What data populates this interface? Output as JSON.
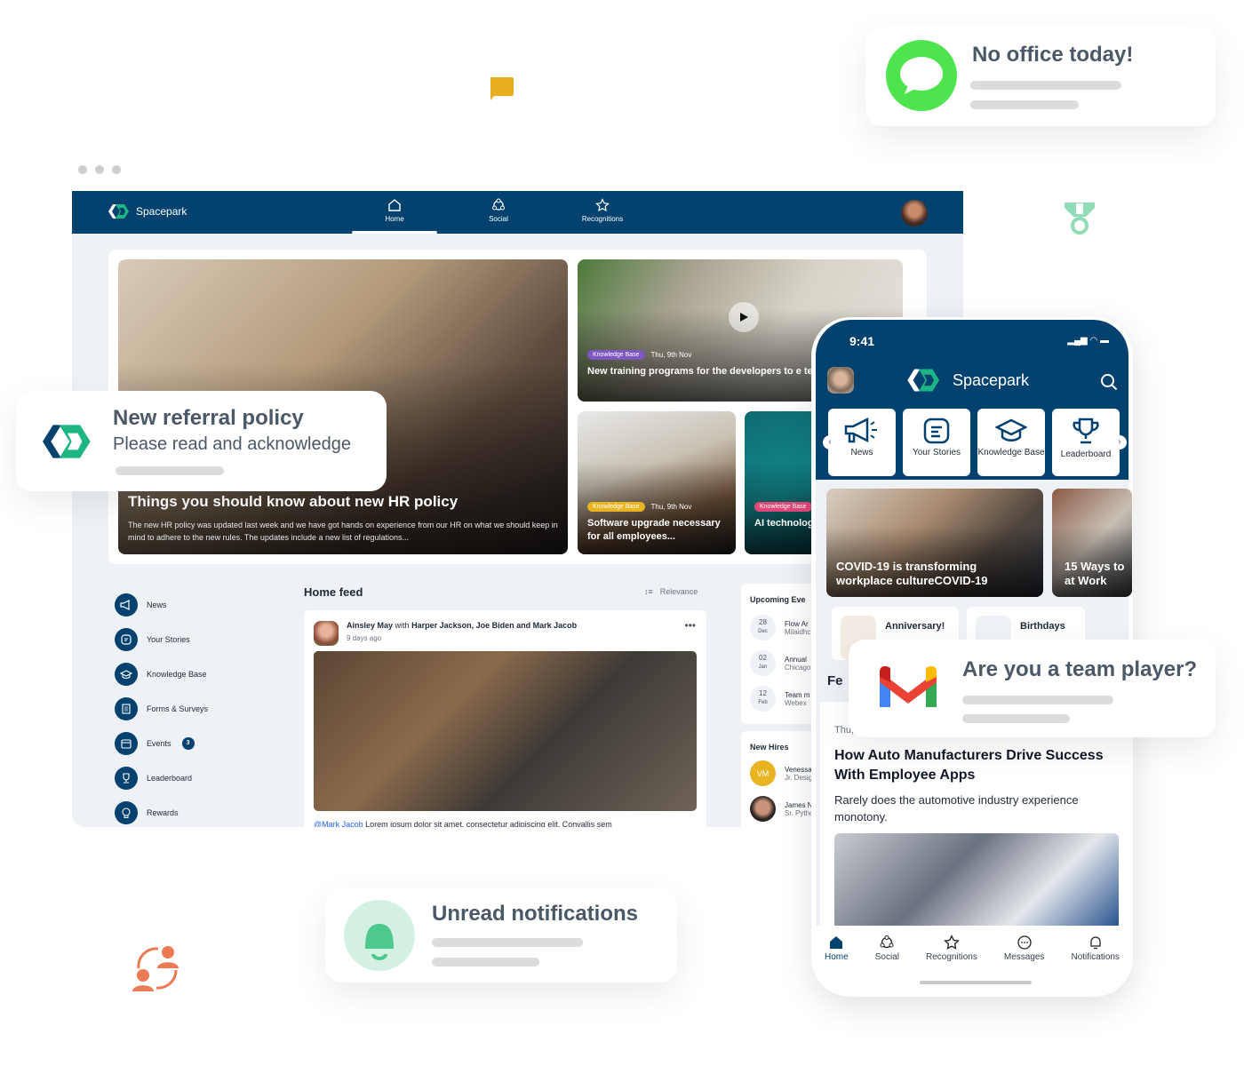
{
  "window_dots": 3,
  "desktop": {
    "brand": "Spacepark",
    "nav": [
      {
        "label": "Home",
        "icon": "home-icon",
        "active": true
      },
      {
        "label": "Social",
        "icon": "social-icon",
        "active": false
      },
      {
        "label": "Recognitions",
        "icon": "star-icon",
        "active": false
      }
    ],
    "hero": {
      "main": {
        "title": "Things you should know about new HR policy",
        "body": "The new HR policy was updated last week and we have got hands on experience from our HR on what we should keep in mind to adhere to the new rules. The updates include a new list of regulations..."
      },
      "top_right": {
        "tag": "Knowledge Base",
        "tag_color": "#7e57c2",
        "date": "Thu, 9th Nov",
        "title": "New training programs for the developers to e technical stack"
      },
      "bottom_left": {
        "tag": "Knowledge Base",
        "tag_color": "#e8b422",
        "date": "Thu, 9th Nov",
        "title": "Software upgrade necessary for all employees..."
      },
      "bottom_right": {
        "tag": "Knowledge Base",
        "tag_color": "#e0487c",
        "title": "AI technolog watch out fo"
      }
    },
    "sidebar": [
      {
        "label": "News",
        "icon": "megaphone-icon"
      },
      {
        "label": "Your Stories",
        "icon": "stories-icon"
      },
      {
        "label": "Knowledge Base",
        "icon": "graduation-cap-icon"
      },
      {
        "label": "Forms & Surveys",
        "icon": "form-icon"
      },
      {
        "label": "Events",
        "icon": "calendar-icon",
        "badge": "3"
      },
      {
        "label": "Leaderboard",
        "icon": "trophy-icon"
      },
      {
        "label": "Rewards",
        "icon": "rewards-icon"
      }
    ],
    "feed": {
      "title": "Home feed",
      "sort_label": "Relevance",
      "post": {
        "author": "Ainsley May",
        "with_word": "with",
        "tagged": "Harper Jackson, Joe Biden and Mark Jacob",
        "time": "9 days ago",
        "mention": "@Mark Jacob",
        "text": "Lorem ipsum dolor sit amet, consectetur adipiscing elit. Convallis sem"
      }
    },
    "upcoming_events": {
      "title": "Upcoming Eve",
      "items": [
        {
          "day": "28",
          "month": "Dec",
          "title": "Flow Ar",
          "sub": "Milaidhc"
        },
        {
          "day": "02",
          "month": "Jan",
          "title": "Annual",
          "sub": "Chicago"
        },
        {
          "day": "12",
          "month": "Feb",
          "title": "Team m",
          "sub": "Webex"
        }
      ]
    },
    "new_hires": {
      "title": "New Hires",
      "items": [
        {
          "initials": "VM",
          "name": "Venessa",
          "role": "Jr. Design"
        },
        {
          "initials": "",
          "name": "James N",
          "role": "Sr. Pytho"
        }
      ]
    }
  },
  "phone": {
    "time": "9:41",
    "brand": "Spacepark",
    "tiles": [
      "News",
      "Your Stories",
      "Knowledge Base",
      "Leaderboard"
    ],
    "stories": [
      {
        "title": "COVID-19 is transforming workplace cultureCOVID-19"
      },
      {
        "title": "15 Ways to at Work"
      }
    ],
    "chips": [
      "Anniversary!",
      "Birthdays"
    ],
    "section_partial": "Fe",
    "article": {
      "date": "Thu,",
      "title": "How Auto Manufacturers Drive Success With Employee Apps",
      "summary": "Rarely does the automotive industry experience monotony."
    },
    "bottom_nav": [
      {
        "label": "Home",
        "active": true
      },
      {
        "label": "Social"
      },
      {
        "label": "Recognitions"
      },
      {
        "label": "Messages"
      },
      {
        "label": "Notifications"
      }
    ]
  },
  "notifications": {
    "office": {
      "title": "No office today!",
      "icon_color": "#4ee44e"
    },
    "referral": {
      "title": "New referral policy",
      "subtitle": "Please read and acknowledge"
    },
    "team": {
      "title": "Are you a team player?"
    },
    "unread": {
      "title": "Unread notifications",
      "icon_color": "#4fc88f"
    }
  },
  "colors": {
    "brand_navy": "#03416f",
    "brand_green": "#1db584",
    "accent_yellow": "#e8b422",
    "accent_orange": "#ec7b55"
  }
}
